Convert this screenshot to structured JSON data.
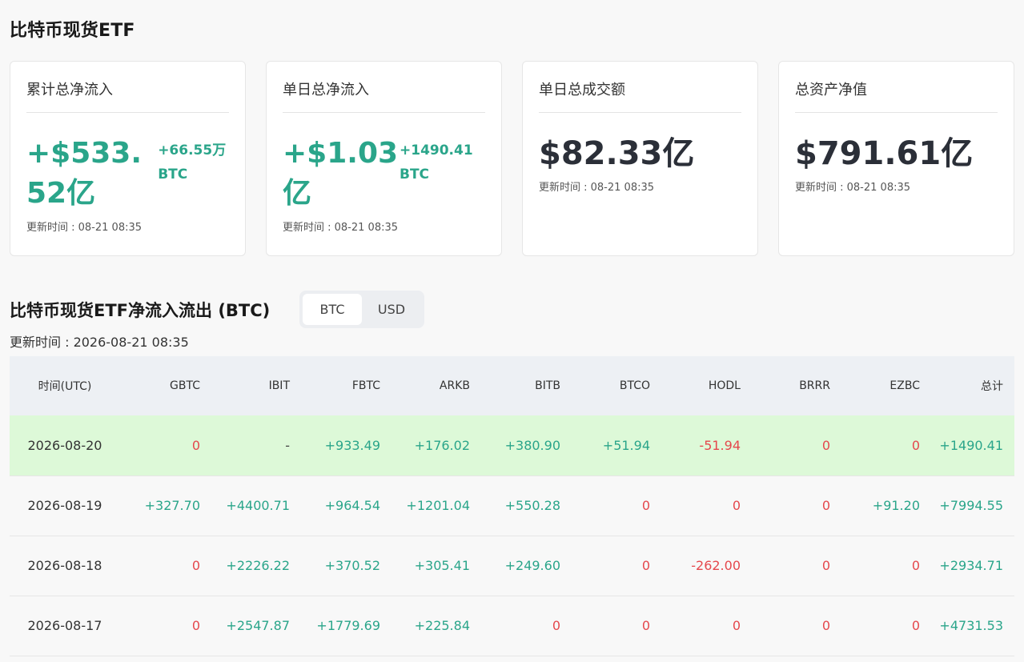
{
  "page_title": "比特币现货ETF",
  "cards": [
    {
      "label": "累计总净流入",
      "main": "+$533.52亿",
      "sub": "+66.55万 BTC",
      "time": "更新时间 : 08-21 08:35"
    },
    {
      "label": "单日总净流入",
      "main": "+$1.03亿",
      "sub": "+1490.41 BTC",
      "time": "更新时间 : 08-21 08:35"
    },
    {
      "label": "单日总成交额",
      "main": "$82.33亿",
      "sub": "",
      "time": "更新时间 : 08-21 08:35"
    },
    {
      "label": "总资产净值",
      "main": "$791.61亿",
      "sub": "",
      "time": "更新时间 : 08-21 08:35"
    }
  ],
  "section": {
    "title": "比特币现货ETF净流入流出 (BTC)",
    "toggle": {
      "btc": "BTC",
      "usd": "USD",
      "active": "BTC"
    },
    "update": "更新时间 : 2026-08-21 08:35"
  },
  "table": {
    "headers": [
      "时间(UTC)",
      "GBTC",
      "IBIT",
      "FBTC",
      "ARKB",
      "BITB",
      "BTCO",
      "HODL",
      "BRRR",
      "EZBC",
      "总计"
    ],
    "rows": [
      [
        "2026-08-20",
        "0",
        "-",
        "+933.49",
        "+176.02",
        "+380.90",
        "+51.94",
        "-51.94",
        "0",
        "0",
        "+1490.41"
      ],
      [
        "2026-08-19",
        "+327.70",
        "+4400.71",
        "+964.54",
        "+1201.04",
        "+550.28",
        "0",
        "0",
        "0",
        "+91.20",
        "+7994.55"
      ],
      [
        "2026-08-18",
        "0",
        "+2226.22",
        "+370.52",
        "+305.41",
        "+249.60",
        "0",
        "-262.00",
        "0",
        "0",
        "+2934.71"
      ],
      [
        "2026-08-17",
        "0",
        "+2547.87",
        "+1779.69",
        "+225.84",
        "0",
        "0",
        "0",
        "0",
        "0",
        "+4731.53"
      ]
    ]
  },
  "colors": {
    "positive": "#2aa58a",
    "negative": "#e5484d",
    "highlight_row": "#ddf9d8",
    "header_bg": "#edf0f4"
  }
}
